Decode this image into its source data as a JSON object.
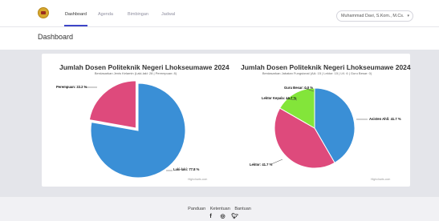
{
  "nav": {
    "items": [
      "Dashboard",
      "Agenda",
      "Bimbingan",
      "Jadwal"
    ],
    "user": "Muhammad Davi, S.Kom., M.Cs."
  },
  "header": {
    "title": "Dashboard"
  },
  "charts": {
    "left": {
      "title": "Jumlah Dosen Politeknik Negeri Lhokseumawe 2024",
      "subtitle": "Berdasarkan Jenis Kelamin (Laki-laki: 28 | Perempuan: 8)",
      "credit": "Highcharts.com",
      "labels": [
        "Perempuan: 22.2 %",
        "Laki-laki: 77.8 %"
      ]
    },
    "right": {
      "title": "Jumlah Dosen Politeknik Negeri Lhokseumawe 2024",
      "subtitle": "Berdasarkan Jabatan Fungsional (AA: 15 | Lektor: 15 | LK: 6 | Guru Besar: 0)",
      "credit": "Highcharts.com",
      "labels": [
        "Guru Besar: 0.0 %",
        "Lektor Kepala: 16.7 %",
        "Asisten Ahli: 41.7 %",
        "Lektor: 41.7 %"
      ]
    }
  },
  "chart_data": [
    {
      "type": "pie",
      "title": "Jumlah Dosen Politeknik Negeri Lhokseumawe 2024",
      "subtitle": "Berdasarkan Jenis Kelamin (Laki-laki: 28 | Perempuan: 8)",
      "categories": [
        "Laki-laki",
        "Perempuan"
      ],
      "values": [
        77.8,
        22.2
      ],
      "colors": [
        "#3a8fd6",
        "#de4a7c"
      ]
    },
    {
      "type": "pie",
      "title": "Jumlah Dosen Politeknik Negeri Lhokseumawe 2024",
      "subtitle": "Berdasarkan Jabatan Fungsional (AA: 15 | Lektor: 15 | LK: 6 | Guru Besar: 0)",
      "categories": [
        "Asisten Ahli",
        "Lektor",
        "Lektor Kepala",
        "Guru Besar"
      ],
      "values": [
        41.7,
        41.7,
        16.7,
        0.0
      ],
      "colors": [
        "#3a8fd6",
        "#de4a7c",
        "#83e53a",
        "#7a4fc4"
      ]
    }
  ],
  "footer": {
    "links": [
      "Panduan",
      "Ketentuan",
      "Bantuan"
    ],
    "social": [
      "facebook-icon",
      "instagram-icon",
      "twitter-icon"
    ]
  }
}
